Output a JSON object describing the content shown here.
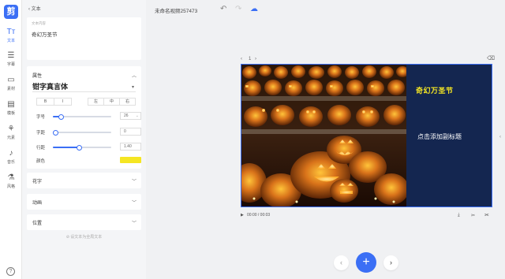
{
  "app": {
    "logo": "剪"
  },
  "rail": [
    {
      "icon": "Tт",
      "label": "文本"
    },
    {
      "icon": "☰",
      "label": "字幕"
    },
    {
      "icon": "▭",
      "label": "素材"
    },
    {
      "icon": "▤",
      "label": "模板"
    },
    {
      "icon": "⚘",
      "label": "元素"
    },
    {
      "icon": "♪",
      "label": "音乐"
    },
    {
      "icon": "⚗",
      "label": "风格"
    }
  ],
  "help": "?",
  "panel": {
    "back": "‹ 文本",
    "text_caption": "文本内容",
    "text_value": "奇幻万圣节",
    "section_property": "属性",
    "font_name": "钳字真言体",
    "style_buttons": [
      "B",
      "I"
    ],
    "align_buttons": [
      "左",
      "中",
      "右"
    ],
    "size_label": "字号",
    "size_value": "26",
    "spacing_label": "字距",
    "spacing_value": "0",
    "line_label": "行距",
    "line_value": "1.40",
    "color_label": "颜色",
    "color_value": "#f5e623",
    "collapsibles": [
      "花字",
      "动画",
      "位置"
    ],
    "save_note": "设文本为全局文本",
    "slider_levels": {
      "size": 0.14,
      "spacing": 0.05,
      "line": 0.45
    }
  },
  "topbar": {
    "project_name": "未命名视频257473",
    "undo": "↶",
    "redo": "↷",
    "cloud": "☁"
  },
  "canvas": {
    "page_prev": "‹",
    "page_number": "1",
    "page_next": "›",
    "trash": "🗑",
    "title": "奇幻万圣节",
    "subtitle": "点击添加副标题",
    "title_color": "#f5e623",
    "bg_color": "#142650",
    "time": "00:00 / 00:03",
    "play": "▶",
    "side_arrow": "‹"
  },
  "bottom": {
    "prev": "‹",
    "add": "+",
    "next": "›"
  }
}
